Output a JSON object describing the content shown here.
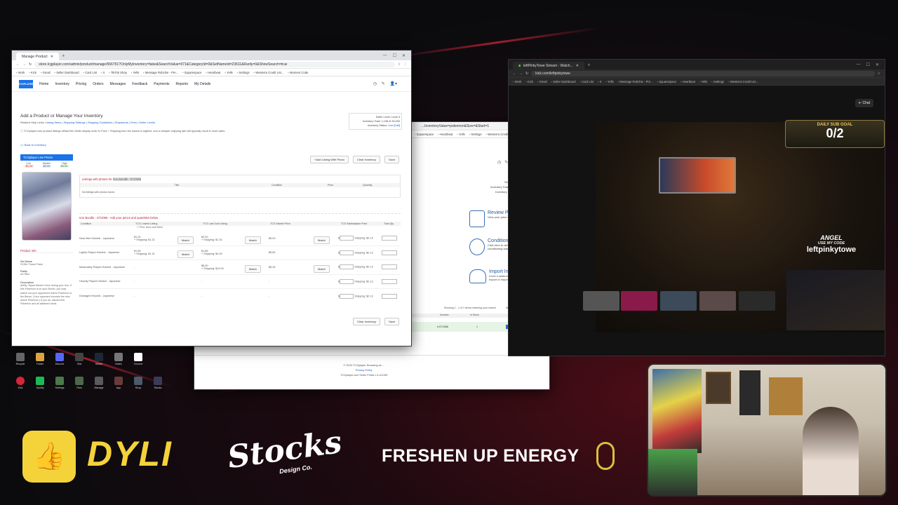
{
  "tcg_window": {
    "tab_title": "Manage Product",
    "url": "store.tcgplayer.com/admin/product/manage/566751?OnlyMyInventory=false&SearchValue=071&CategoryId=0&SetNameId=23611&Rarity=0&ShowSearch=true",
    "bookmarks": [
      "Work",
      "Kick",
      "Gmail",
      "Seller Dashboard",
      "Card List",
      "X",
      "TikTok Shop",
      "Yells",
      "Message Robchie - Pre...",
      "Squarespace",
      "Heartbeat",
      "Yells",
      "Settings",
      "Westerra Credit Uni...",
      "Moment Code"
    ],
    "logo_text": "TCGPLAYER",
    "nav": [
      "Home",
      "Inventory",
      "Pricing",
      "Orders",
      "Messages",
      "Feedback",
      "Payments",
      "Reports",
      "My Details"
    ],
    "page_title": "Add a Product or Manage Your Inventory",
    "help_prefix": "Related Help Links:",
    "help_links": [
      "Listing Items",
      "Shipping Settings",
      "Shipping Guidelines",
      "Shipments",
      "Fees",
      "Seller Levels"
    ],
    "seller_level_label": "Seller Level:",
    "seller_level_value": "Level 3",
    "inventory_total_label": "Inventory Total:",
    "inventory_total_value": "1,198 of 30,000",
    "inventory_status_label": "Inventory Status:",
    "inventory_status_value": "Live [Edit]",
    "info_note": "TCGplayer.com product listings default the Seller display order to Price + Shipping from the lowest to highest, and a cheaper shipping rate will typically result in more sales.",
    "back_link": "<< Back to Inventory",
    "live_prices_title": "TCGplayer Live Prices",
    "price_low_label": "Low",
    "price_low": "$1.24",
    "price_market_label": "Market",
    "price_market": "$2.00",
    "price_high_label": "High",
    "price_high": "$5.00",
    "top_buttons": [
      "+Add Listing With Photo",
      "Clear Inventory",
      "Save"
    ],
    "listings_with_photos_title": "Listings with photos for",
    "listings_with_photos_product": "Iron Bundle - 071/066",
    "photo_headers": [
      "Title",
      "Condition",
      "Price",
      "Quantity"
    ],
    "no_photo_listings": "No listings with photos found.",
    "section_title": "Iron Bundle - 071/066 - Add your prices and quantities below",
    "table_headers": [
      "Condition",
      "TCG Lowest Listing",
      "TCG Last Sold Listing",
      "TCG Market Price",
      "TCG Marketplace Price",
      "Total Qty"
    ],
    "print_note": "Print, show sold listed",
    "rows": [
      {
        "condition": "Near Mint Holofoil - Japanese",
        "lowest": "$1.24",
        "lowest_ship": "+ Shipping: $1.31",
        "last": "$2.00",
        "last_ship": "+ Shipping: $1.31",
        "market": "$5.00",
        "ship": "Shipping: $2.13"
      },
      {
        "condition": "Lightly Played Holofoil - Japanese",
        "lowest": "$1.95",
        "lowest_ship": "+ Shipping: $1.31",
        "last": "$1.85",
        "last_ship": "+ Shipping: $4.49",
        "market": "$5.84",
        "ship": "Shipping: $2.13"
      },
      {
        "condition": "Moderately Played Holofoil - Japanese",
        "lowest": "-",
        "lowest_ship": "",
        "last": "$6.00",
        "last_ship": "+ Shipping: $10.00",
        "market": "$5.49",
        "ship": "Shipping: $2.13"
      },
      {
        "condition": "Heavily Played Holofoil - Japanese",
        "lowest": "-",
        "lowest_ship": "",
        "last": "-",
        "last_ship": "",
        "market": "-",
        "ship": "Shipping: $2.13"
      },
      {
        "condition": "Damaged Holofoil - Japanese",
        "lowest": "-",
        "lowest_ship": "",
        "last": "-",
        "last_ship": "",
        "market": "-",
        "ship": "Shipping: $2.13"
      }
    ],
    "match_label": "Match",
    "bottom_buttons": [
      "Clear Inventory",
      "Save"
    ],
    "product_info_title": "Product Info",
    "set_name_label": "Set Name",
    "set_name_value": "SV5M: Future Flash",
    "rarity_label": "Rarity",
    "rarity_value": "Art Rare",
    "description_label": "Description",
    "description_text": "Ability: Hyper Blower Once during your turn, if this Pokémon is on your Bench, you may switch out your opponent's Active Pokémon to the Bench. (Your opponent chooses the new Active Pokémon.) If you do, discard this Pokémon and all attached cards."
  },
  "tcg_back_window": {
    "url": "...InventoryValue=pokemon&Size=&Start=1",
    "bookmarks": [
      "Squarespace",
      "Heartbeat",
      "Yells",
      "Settings",
      "Westerra Credit Uni..."
    ],
    "seller_level": "Seller Level: Level 3",
    "inventory_total": "Inventory Total: 1,198 of 30,000",
    "inventory_status": "Inventory Status: Live [Edit]",
    "features": [
      {
        "title": "Review Prices",
        "desc": "View your price differential report."
      },
      {
        "title": "Condition Your Cards",
        "desc": "Click here to view the industry conditioning standards."
      },
      {
        "title": "Import Inventory",
        "desc": "Level 4 sellers! Access the Pricing tab to export or import inventory."
      }
    ],
    "showing_text": "Showing 1 - 1 of 1 items matching your search",
    "items_per_page_label": "Items per page",
    "items_per_page": "25",
    "result_headers": [
      "Number",
      "In Stock"
    ],
    "result_number": "#:071/066",
    "result_stock": "1",
    "manage_label": "Manage",
    "footer_copy": "© 2025 TCGplayer. Browsing as ... ",
    "footer_privacy": "Privacy Policy",
    "footer_portal": "TCGplayer.com Seller Portal v.3.112155"
  },
  "kick_window": {
    "tab_title": "leftPinkyTowe Stream - Watch...",
    "url": "kick.com/leftpinkytowe",
    "chat_label": "Chat",
    "sub_goal_title": "DAILY SUB GOAL",
    "sub_goal_value": "0/2",
    "code_line1": "USE MY CODE",
    "code_name": "leftpinkytowe",
    "code_prefix": "ANGEL"
  },
  "desktop_icons": [
    "Recycle",
    "Folder",
    "Discord",
    "Obs",
    "Steam",
    "Notes",
    "Chrome",
    "Kick",
    "Spotify",
    "Settings",
    "Files",
    "Manage",
    "App",
    "Shop",
    "Stocks",
    "Folder"
  ],
  "sponsors": {
    "dyli": "DYLI",
    "stocks": "Stocks",
    "stocks_sub": "Design Co.",
    "freshen": "FRESHEN UP ENERGY"
  },
  "colors": {
    "accent_red": "#c4122f",
    "tcg_blue": "#1a5fc8",
    "kick_green": "#53fc18",
    "goal_gold": "#e9c45a"
  }
}
